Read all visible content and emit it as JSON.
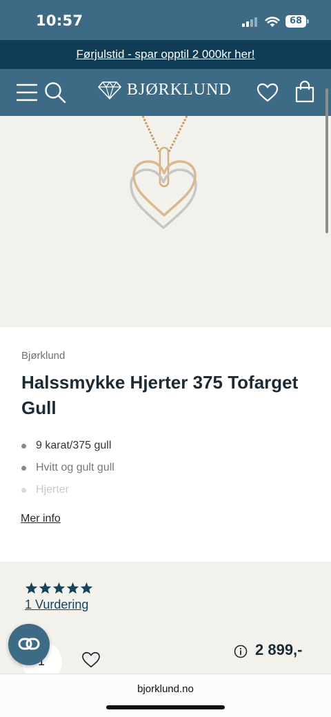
{
  "status_bar": {
    "time": "10:57",
    "battery": "68",
    "icons": [
      "signal-icon",
      "wifi-icon",
      "battery-icon"
    ]
  },
  "promo": {
    "text": "Førjulstid - spar opptil 2 000kr her!"
  },
  "header": {
    "logo_text": "BJØRKLUND",
    "icons": [
      "menu-icon",
      "search-icon",
      "diamond-logo-icon",
      "heart-icon",
      "cart-icon"
    ]
  },
  "product": {
    "brand": "Bjørklund",
    "title": "Halssmykke Hjerter 375 Tofarget Gull",
    "features": [
      "9 karat/375 gull",
      "Hvitt og gult gull",
      "Hjerter"
    ],
    "more_info": "Mer info",
    "rating_stars": 5,
    "rating_link": "1 Vurdering",
    "quantity": "1",
    "price": "2 899,-"
  },
  "browser": {
    "url": "bjorklund.no"
  },
  "colors": {
    "header_teal": "#3d6a85",
    "promo_navy": "#0f3b55",
    "star_blue": "#17435d",
    "page_beige": "#f3f1ec"
  }
}
